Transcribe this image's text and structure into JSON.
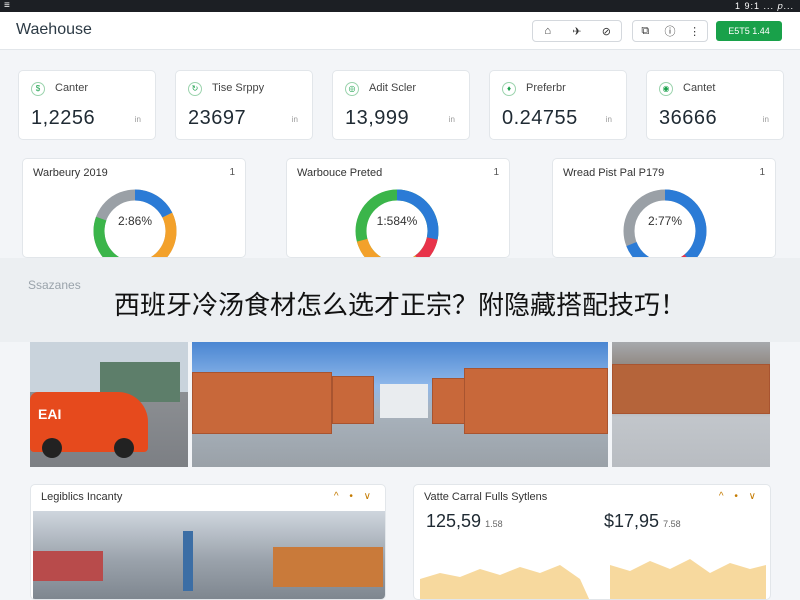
{
  "system": {
    "menu_icon": "hamburger-icon",
    "status_text": "1 9:1 ... 𝑝..."
  },
  "header": {
    "title": "Waehouse",
    "tools_group1": [
      "home-icon",
      "pin-icon",
      "link-icon"
    ],
    "tools_group2": [
      "camera-icon",
      "info-icon",
      "more-icon"
    ],
    "action_label": "E5T5 1.44"
  },
  "kpis": [
    {
      "label": "Canter",
      "value": "1,2256",
      "extra": "in"
    },
    {
      "label": "Tise Srppy",
      "value": "23697",
      "extra": "in"
    },
    {
      "label": "Adit Scler",
      "value": "13,999",
      "extra": "in"
    },
    {
      "label": "Preferbr",
      "value": "0.24755",
      "extra": "in"
    },
    {
      "label": "Cantet",
      "value": "36666",
      "extra": "in"
    }
  ],
  "donuts": [
    {
      "title": "Warbeury 2019",
      "num": "1",
      "center": "2:86%"
    },
    {
      "title": "Warbouce Preted",
      "num": "1",
      "center": "1:584%"
    },
    {
      "title": "Wread Pist Pal P179",
      "num": "1",
      "center": "2:77%"
    }
  ],
  "overlay": {
    "ghost_text": "Ssazanes",
    "headline": "西班牙冷汤食材怎么选才正宗？附隐藏搭配技巧！"
  },
  "photos": {
    "van_logo": "EAI"
  },
  "bottom": [
    {
      "title": "Legiblics Incanty",
      "icons": "^ • ∨"
    },
    {
      "title": "Vatte Carral Fulls Sytlens",
      "icons": "^ • ∨",
      "metric1": "125,59",
      "metric1_unit": "1.58",
      "metric2": "$17,95",
      "metric2_unit": "7.58"
    }
  ],
  "colors": {
    "accent": "#19a14a",
    "donut_blue": "#2b7bd6",
    "donut_orange": "#f3a12b",
    "donut_green": "#3bb54a",
    "donut_gray": "#9aa0a6",
    "donut_red": "#e8334a"
  }
}
